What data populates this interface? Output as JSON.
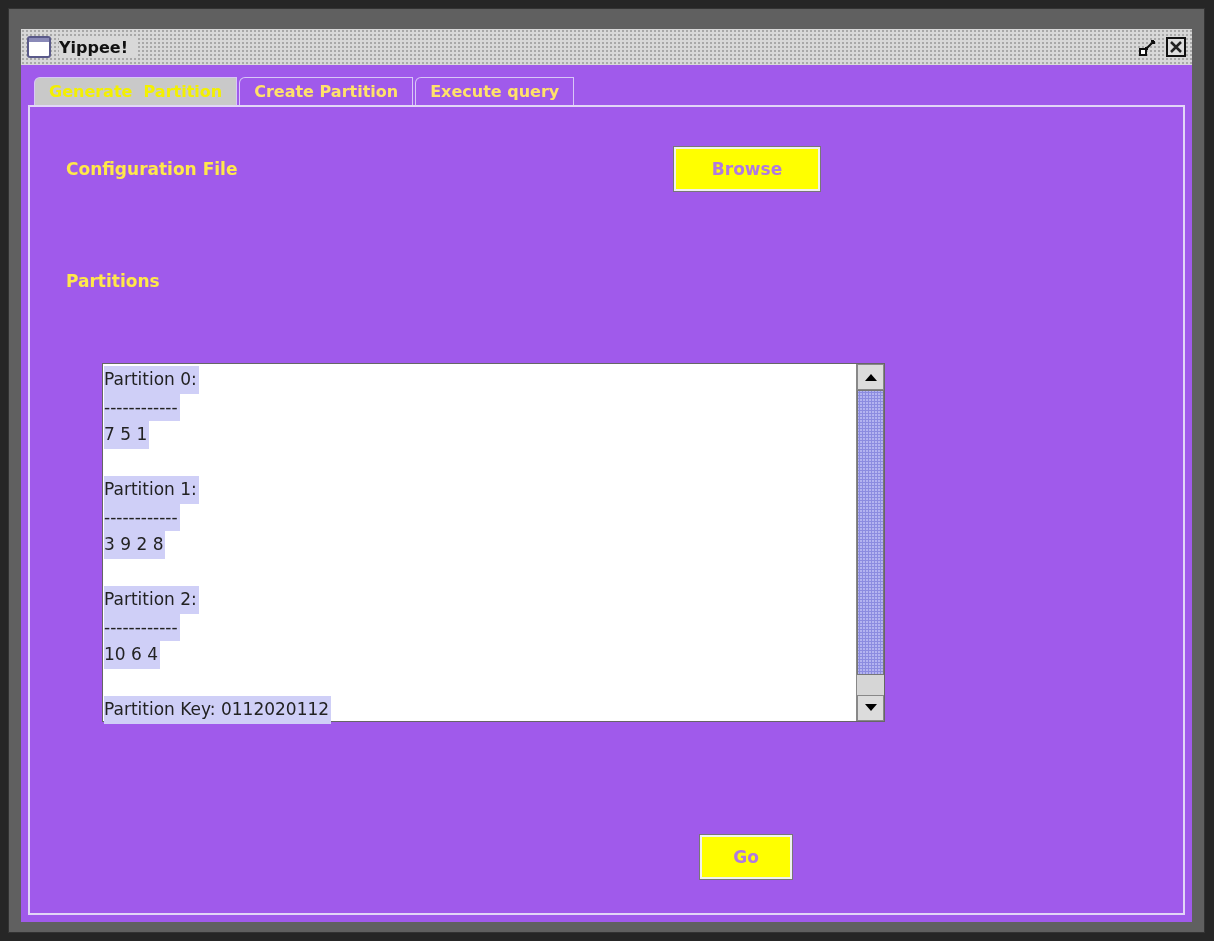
{
  "window": {
    "title": "Yippee!"
  },
  "tabs": [
    {
      "label": "Generate  Partition",
      "selected": true
    },
    {
      "label": "Create Partition",
      "selected": false
    },
    {
      "label": "Execute query",
      "selected": false
    }
  ],
  "config": {
    "label": "Configuration File",
    "button": "Browse"
  },
  "partitions": {
    "label": "Partitions",
    "text_selected": true,
    "groups": [
      {
        "title": "Partition 0:",
        "rule": "------------",
        "values": "7 5 1"
      },
      {
        "title": "Partition 1:",
        "rule": "------------",
        "values": "3 9 2 8"
      },
      {
        "title": "Partition 2:",
        "rule": "------------",
        "values": "10 6 4"
      }
    ],
    "key": "Partition Key: 0112020112"
  },
  "go_button": "Go"
}
